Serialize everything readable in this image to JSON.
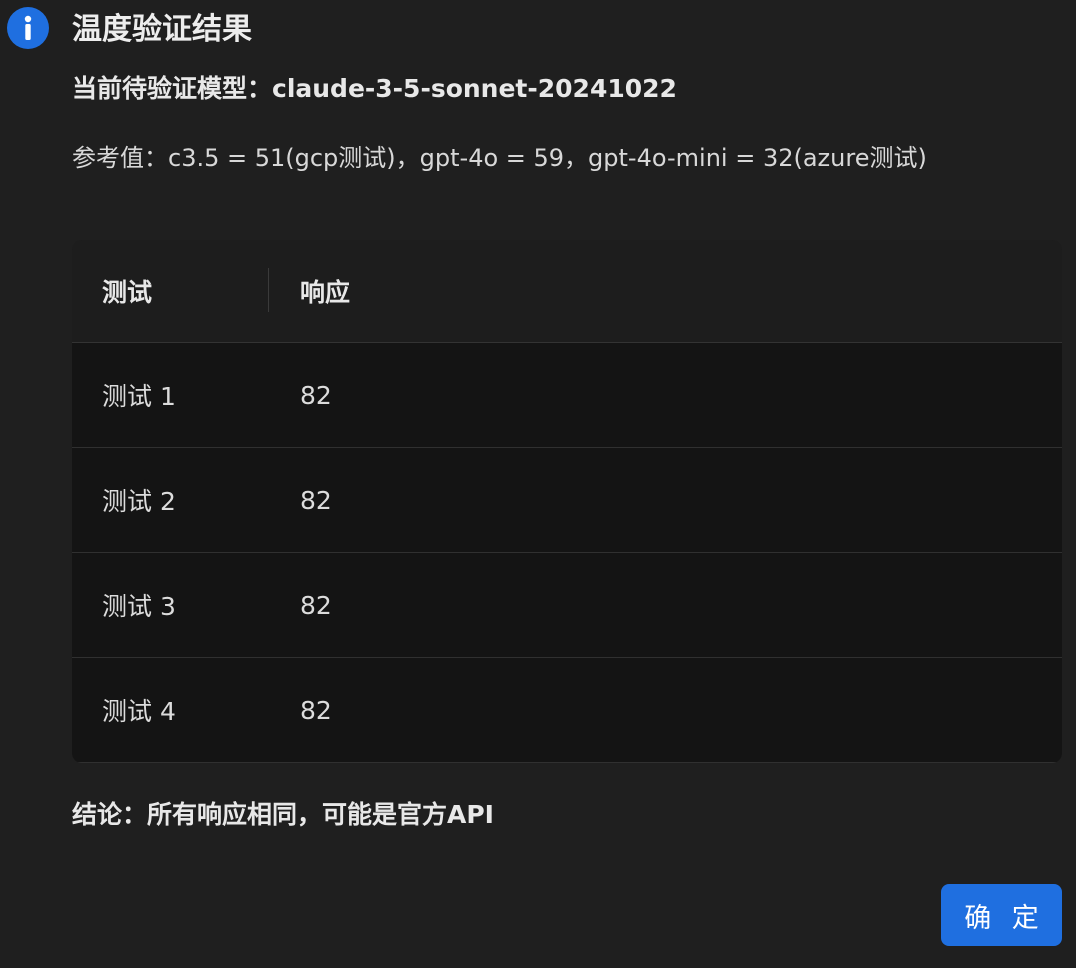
{
  "dialog": {
    "icon": "info-icon",
    "title": "温度验证结果",
    "model_line": "当前待验证模型：claude-3-5-sonnet-20241022",
    "reference_line": "参考值：c3.5 = 51(gcp测试)，gpt-4o = 59，gpt-4o-mini = 32(azure测试)",
    "conclusion": "结论：所有响应相同，可能是官方API",
    "ok_label": "确 定",
    "accent_color": "#1f6fe0"
  },
  "table": {
    "headers": {
      "test": "测试",
      "response": "响应"
    },
    "rows": [
      {
        "test": "测试 1",
        "response": "82"
      },
      {
        "test": "测试 2",
        "response": "82"
      },
      {
        "test": "测试 3",
        "response": "82"
      },
      {
        "test": "测试 4",
        "response": "82"
      }
    ]
  }
}
